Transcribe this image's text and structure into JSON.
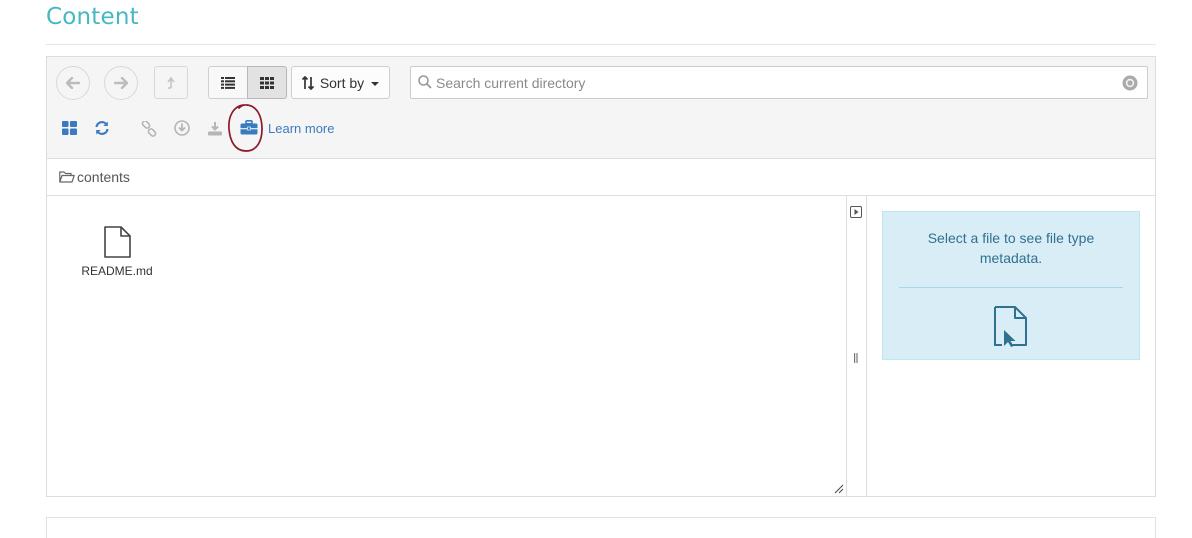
{
  "page": {
    "title": "Content"
  },
  "toolbar": {
    "back_icon": "arrow-left-icon",
    "forward_icon": "arrow-right-icon",
    "up_icon": "level-up-icon",
    "list_view_icon": "list-icon",
    "grid_view_icon": "grid-icon",
    "sort_label": "Sort by",
    "search_placeholder": "Search current directory",
    "actions": [
      "dashboard-icon",
      "refresh-icon",
      "link-icon",
      "download-circle-icon",
      "download-icon",
      "briefcase-icon"
    ],
    "learn_more": "Learn more",
    "annotation_color": "#8b1a2b"
  },
  "breadcrumb": {
    "label": "contents"
  },
  "files": [
    {
      "name": "README.md",
      "icon": "file-icon"
    }
  ],
  "metadata": {
    "message": "Select a file to see file type metadata.",
    "icon": "file-pointer-icon"
  },
  "colors": {
    "title": "#46b8c3",
    "accent": "#3a7bbf",
    "info_bg": "#d9edf7",
    "info_text": "#31708f"
  }
}
